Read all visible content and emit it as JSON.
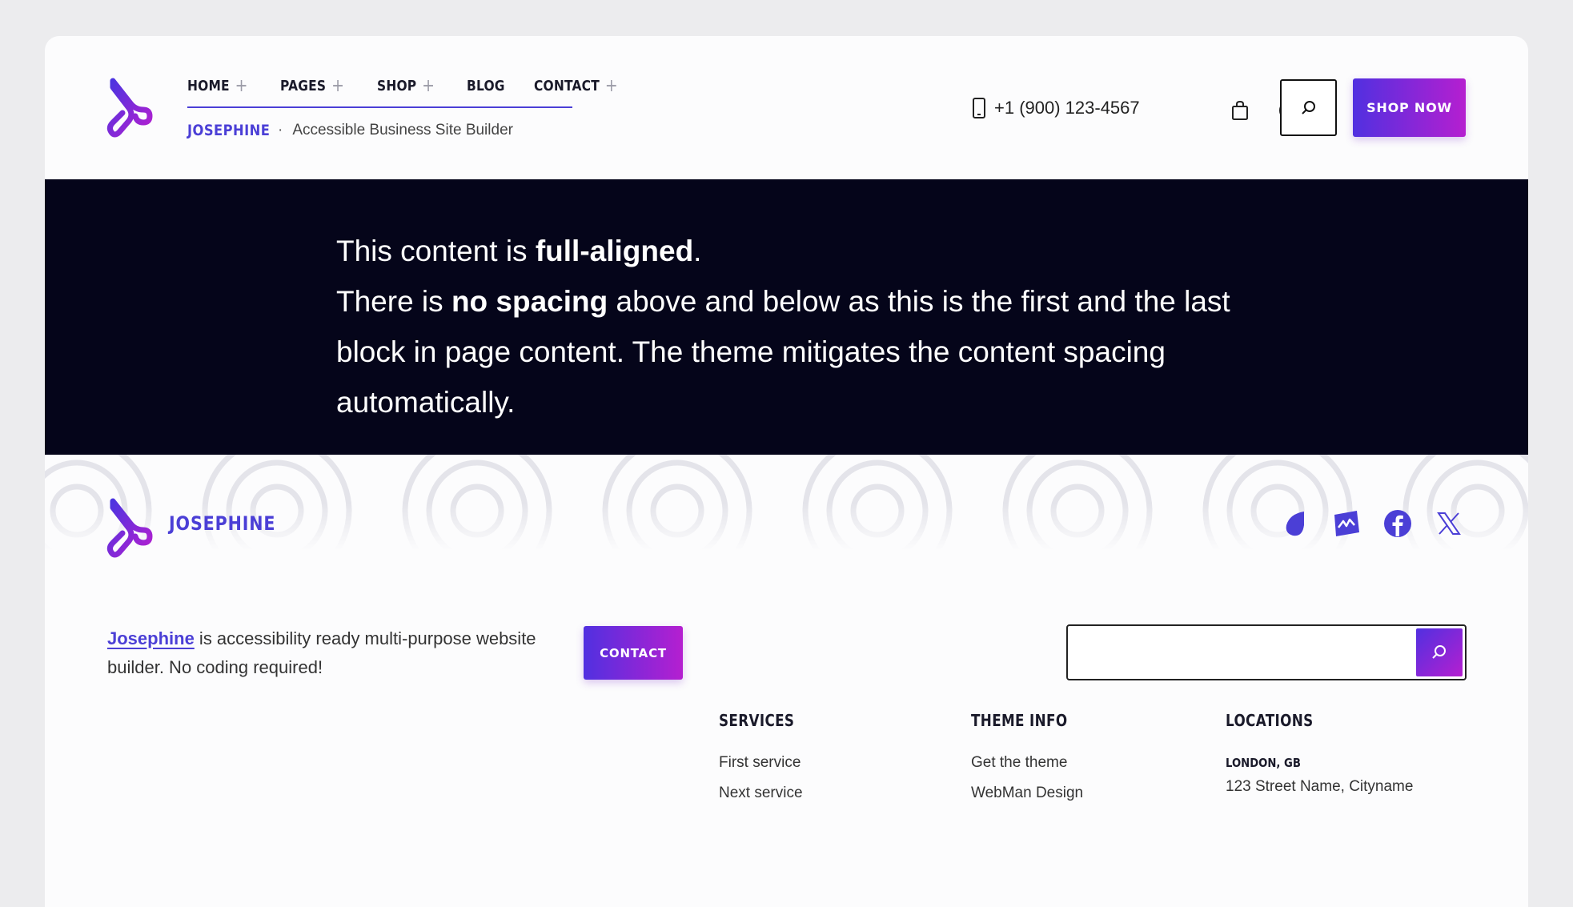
{
  "header": {
    "nav": [
      {
        "label": "HOME",
        "has_submenu": true
      },
      {
        "label": "PAGES",
        "has_submenu": true
      },
      {
        "label": "SHOP",
        "has_submenu": true
      },
      {
        "label": "BLOG",
        "has_submenu": false
      },
      {
        "label": "CONTACT",
        "has_submenu": true
      }
    ],
    "brand": "JOSEPHINE",
    "separator": "·",
    "tagline": "Accessible Business Site Builder",
    "phone": "+1 (900) 123-4567",
    "shop_now": "SHOP NOW",
    "icons": [
      "phone-icon",
      "bag-icon",
      "user-icon",
      "search-icon"
    ]
  },
  "hero": {
    "line1_pre": "This content is ",
    "line1_bold": "full-aligned",
    "line1_post": ".",
    "line2_pre": "There is ",
    "line2_bold": "no spacing",
    "line2_post": " above and below as this is the first and the last block in page content. The theme mitigates the content spacing automatically."
  },
  "footer": {
    "brand": "JOSEPHINE",
    "social": [
      "droplet-icon",
      "chart-icon",
      "facebook-icon",
      "x-icon"
    ],
    "about_link": "Josephine",
    "about_text": " is accessibility ready multi-purpose website builder. No coding required!",
    "contact_button": "CONTACT",
    "search_placeholder": "",
    "columns": {
      "services": {
        "title": "SERVICES",
        "links": [
          "First service",
          "Next service"
        ]
      },
      "theme_info": {
        "title": "THEME INFO",
        "links": [
          "Get the theme",
          "WebMan Design"
        ]
      },
      "locations": {
        "title": "LOCATIONS",
        "city": "LONDON, GB",
        "address": "123 Street Name, Cityname"
      }
    }
  },
  "colors": {
    "accent": "#4b3fd6",
    "gradient_start": "#5130e0",
    "gradient_end": "#b51fd0",
    "hero_bg": "#05051a"
  }
}
